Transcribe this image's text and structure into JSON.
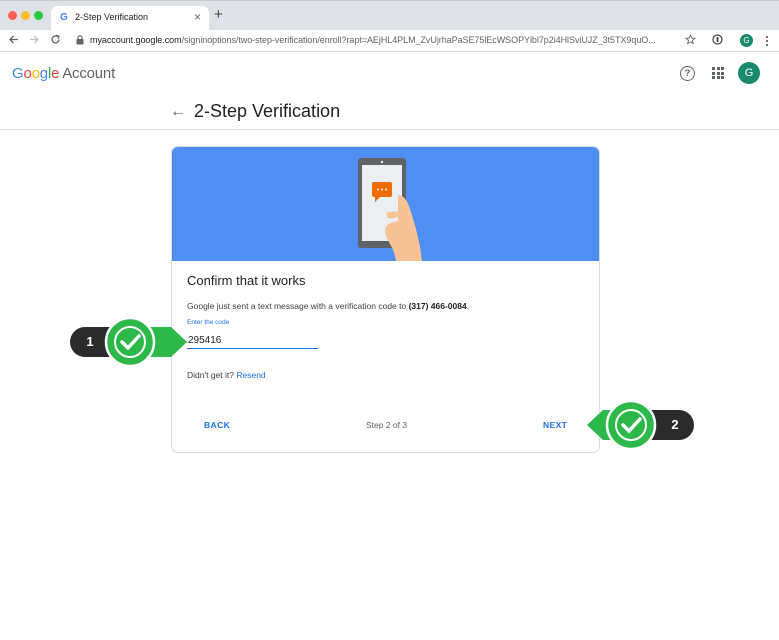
{
  "browser": {
    "tab_title": "2-Step Verification",
    "tab_favicon": "G",
    "tab_close": "×",
    "new_tab": "+",
    "url_host": "myaccount.google.com",
    "url_path": "/signinoptions/two-step-verification/enroll?rapt=AEjHL4PLM_ZvUjrhaPaSE75lEcWSOPYlbl7p2i4HlSviUJZ_3t5TX9quO...",
    "profile_initial": "G",
    "icons": [
      "back-icon",
      "forward-icon",
      "reload-icon",
      "lock-icon",
      "star-icon",
      "extension-icon",
      "menu-icon"
    ]
  },
  "header": {
    "logo_google": "Google",
    "logo_account": "Account",
    "help": "?",
    "avatar_initial": "G"
  },
  "page": {
    "back_arrow": "←",
    "title": "2-Step Verification"
  },
  "card": {
    "heading": "Confirm that it works",
    "description_prefix": "Google just sent a text message with a verification code to ",
    "phone": "(317) 466-0084",
    "description_suffix": ".",
    "field_label": "Enter the code",
    "field_value": "295416",
    "resend_prefix": "Didn't get it?",
    "resend_link": "Resend",
    "back_button": "BACK",
    "step_text": "Step 2 of 3",
    "next_button": "NEXT"
  },
  "callouts": [
    {
      "number": "1"
    },
    {
      "number": "2"
    }
  ],
  "colors": {
    "accent": "#1a73e8",
    "banner": "#4f8ef3",
    "callout_green": "#2db84a",
    "callout_dark": "#2b2b2b"
  }
}
